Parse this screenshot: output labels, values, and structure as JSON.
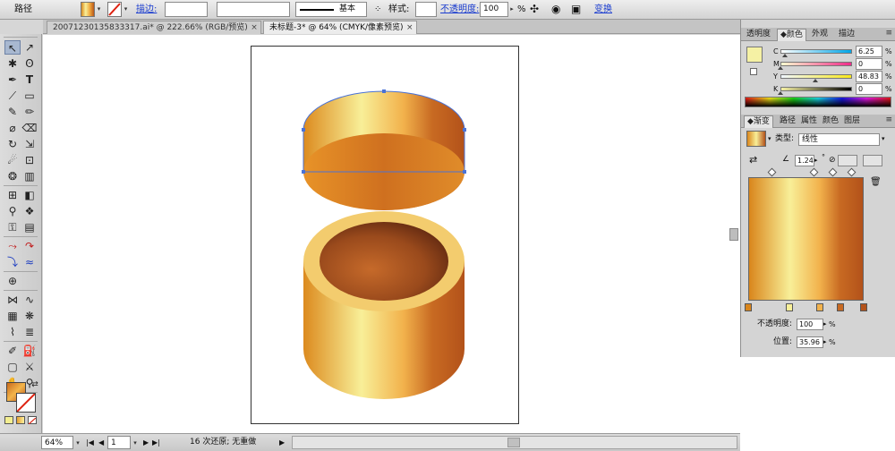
{
  "control_bar": {
    "selection_type": "路径",
    "stroke_label": "描边:",
    "stroke_profile": "基本",
    "style_label": "样式:",
    "opacity_label": "不透明度:",
    "opacity_value": "100",
    "opacity_unit": "%",
    "transform_label": "变换"
  },
  "tabs": [
    {
      "label": "20071230135833317.ai* @ 222.66% (RGB/预览)",
      "active": false
    },
    {
      "label": "未标题-3* @ 64% (CMYK/像素预览)",
      "active": true
    }
  ],
  "close_glyph": "×",
  "color_panel": {
    "tabs": [
      "透明度",
      "颜色",
      "外观",
      "描边"
    ],
    "active_tab": "颜色",
    "channels": [
      {
        "name": "C",
        "value": "6.25",
        "fraction": 0.0625
      },
      {
        "name": "M",
        "value": "0",
        "fraction": 0.0
      },
      {
        "name": "Y",
        "value": "48.83",
        "fraction": 0.4883
      },
      {
        "name": "K",
        "value": "0",
        "fraction": 0.0
      }
    ],
    "unit": "%",
    "current_color": "#f5f1a4"
  },
  "gradient_panel": {
    "tabs": [
      "渐变",
      "路径",
      "属性",
      "颜色",
      "图层"
    ],
    "active_tab": "渐变",
    "type_label": "类型:",
    "type_value": "线性",
    "angle_value": "1.24",
    "degree_symbol": "°",
    "opacity_label": "不透明度:",
    "opacity_value": "100",
    "location_label": "位置:",
    "location_value": "35.96",
    "unit": "%",
    "stops": [
      {
        "color": "#d9861c",
        "position": 0
      },
      {
        "color": "#f8ef98",
        "position": 0.36
      },
      {
        "color": "#f2b24c",
        "position": 0.62
      },
      {
        "color": "#c86a22",
        "position": 0.8
      },
      {
        "color": "#b3521a",
        "position": 1.0
      }
    ],
    "midpoints": [
      0.21,
      0.57,
      0.74,
      0.9
    ]
  },
  "status_bar": {
    "zoom": "64%",
    "page": "1",
    "undo_text": "16 次还原; 无重做"
  },
  "icons": {
    "dropdown": "▾",
    "dropdown_right": "▸",
    "first": "|◀",
    "prev": "◀",
    "next": "▶",
    "last": "▶|"
  }
}
